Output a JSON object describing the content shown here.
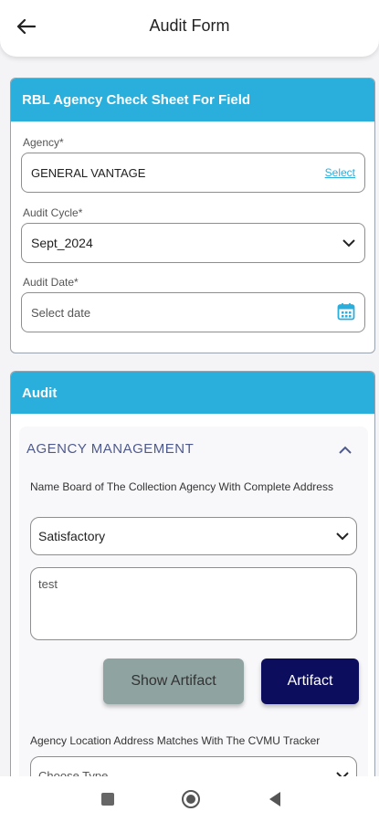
{
  "appbar": {
    "title": "Audit Form",
    "back_icon": "arrow-left-icon"
  },
  "form_card": {
    "header": "RBL Agency Check Sheet For Field",
    "agency": {
      "label": "Agency*",
      "value": "GENERAL VANTAGE",
      "action": "Select"
    },
    "audit_cycle": {
      "label": "Audit Cycle*",
      "value": "Sept_2024"
    },
    "audit_date": {
      "label": "Audit Date*",
      "placeholder": "Select date",
      "icon": "calendar-icon"
    }
  },
  "audit_card": {
    "header": "Audit",
    "section": {
      "title": "AGENCY MANAGEMENT",
      "questions": [
        {
          "text": "Name Board of The Collection Agency With Complete Address",
          "value": "Satisfactory",
          "remark": "test"
        },
        {
          "text": "Agency Location Address Matches With The CVMU Tracker",
          "placeholder": "Choose Type"
        }
      ],
      "buttons": {
        "show_artifact": "Show Artifact",
        "artifact": "Artifact"
      }
    }
  },
  "colors": {
    "header_bg": "#2aaedc",
    "section_title": "#4e5a8e",
    "primary_button": "#0d0d5e",
    "secondary_button": "#8fa3a1"
  }
}
